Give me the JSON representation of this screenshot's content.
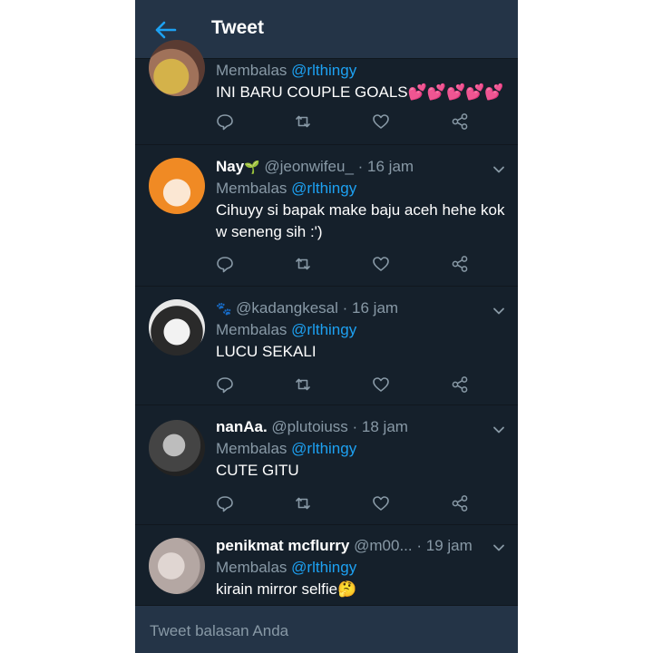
{
  "app": {
    "title": "Tweet"
  },
  "colors": {
    "background": "#15202b",
    "topbar": "#243447",
    "accent": "#1da1f2",
    "muted": "#8899a6"
  },
  "tweets": [
    {
      "name": "",
      "handle": "",
      "time": "",
      "reply_label": "Membalas",
      "reply_to": "@rlthingy",
      "text": "INI BARU COUPLE GOALS💕💕💕💕💕",
      "avatar": "yellow-shirt-photo"
    },
    {
      "name": "Nay",
      "name_emoji": "🌱",
      "handle": "@jeonwifeu_",
      "time": "16 jam",
      "reply_label": "Membalas",
      "reply_to": "@rlthingy",
      "text": "Cihuyy si bapak make baju aceh hehe kok w seneng sih :')",
      "avatar": "anime-girl-orange"
    },
    {
      "name": "",
      "name_emoji": "🐾",
      "handle": "@kadangkesal",
      "time": "16 jam",
      "reply_label": "Membalas",
      "reply_to": "@rlthingy",
      "text": "LUCU SEKALI",
      "avatar": "manga-girl-bw"
    },
    {
      "name": "nanAa.",
      "handle": "@plutoiuss",
      "time": "18 jam",
      "reply_label": "Membalas",
      "reply_to": "@rlthingy",
      "text": "CUTE GITU",
      "avatar": "bw-photo"
    },
    {
      "name": "penikmat mcflurry",
      "handle": "@m00...",
      "time": "19 jam",
      "reply_label": "Membalas",
      "reply_to": "@rlthingy",
      "text": "kirain mirror selfie🤔",
      "avatar": "blurry-photo"
    }
  ],
  "icons": {
    "back": "arrow-left-icon",
    "reply": "reply-icon",
    "retweet": "retweet-icon",
    "like": "heart-icon",
    "share": "share-icon",
    "menu": "chevron-down-icon"
  },
  "compose": {
    "placeholder": "Tweet balasan Anda"
  }
}
